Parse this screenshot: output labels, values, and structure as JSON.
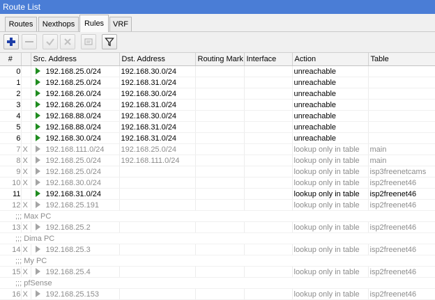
{
  "window": {
    "title": "Route List"
  },
  "tabs": [
    {
      "label": "Routes",
      "active": false
    },
    {
      "label": "Nexthops",
      "active": false
    },
    {
      "label": "Rules",
      "active": true
    },
    {
      "label": "VRF",
      "active": false
    }
  ],
  "toolbar": [
    {
      "icon": "plus-icon",
      "enabled": true
    },
    {
      "icon": "minus-icon",
      "enabled": false
    },
    {
      "icon": "check-icon",
      "enabled": false
    },
    {
      "icon": "cross-icon",
      "enabled": false
    },
    {
      "icon": "note-icon",
      "enabled": false
    },
    {
      "icon": "filter-icon",
      "enabled": true
    }
  ],
  "columns": [
    "#",
    "",
    "Src. Address",
    "Dst. Address",
    "Routing Mark",
    "Interface",
    "Action",
    "Table"
  ],
  "rows": [
    {
      "type": "rule",
      "num": "0",
      "flag": "",
      "disabled": false,
      "src": "192.168.25.0/24",
      "dst": "192.168.30.0/24",
      "mark": "",
      "iface": "",
      "action": "unreachable",
      "table": ""
    },
    {
      "type": "rule",
      "num": "1",
      "flag": "",
      "disabled": false,
      "src": "192.168.25.0/24",
      "dst": "192.168.31.0/24",
      "mark": "",
      "iface": "",
      "action": "unreachable",
      "table": ""
    },
    {
      "type": "rule",
      "num": "2",
      "flag": "",
      "disabled": false,
      "src": "192.168.26.0/24",
      "dst": "192.168.30.0/24",
      "mark": "",
      "iface": "",
      "action": "unreachable",
      "table": ""
    },
    {
      "type": "rule",
      "num": "3",
      "flag": "",
      "disabled": false,
      "src": "192.168.26.0/24",
      "dst": "192.168.31.0/24",
      "mark": "",
      "iface": "",
      "action": "unreachable",
      "table": ""
    },
    {
      "type": "rule",
      "num": "4",
      "flag": "",
      "disabled": false,
      "src": "192.168.88.0/24",
      "dst": "192.168.30.0/24",
      "mark": "",
      "iface": "",
      "action": "unreachable",
      "table": ""
    },
    {
      "type": "rule",
      "num": "5",
      "flag": "",
      "disabled": false,
      "src": "192.168.88.0/24",
      "dst": "192.168.31.0/24",
      "mark": "",
      "iface": "",
      "action": "unreachable",
      "table": ""
    },
    {
      "type": "rule",
      "num": "6",
      "flag": "",
      "disabled": false,
      "src": "192.168.30.0/24",
      "dst": "192.168.31.0/24",
      "mark": "",
      "iface": "",
      "action": "unreachable",
      "table": ""
    },
    {
      "type": "rule",
      "num": "7",
      "flag": "X",
      "disabled": true,
      "src": "192.168.111.0/24",
      "dst": "192.168.25.0/24",
      "mark": "",
      "iface": "",
      "action": "lookup only in table",
      "table": "main"
    },
    {
      "type": "rule",
      "num": "8",
      "flag": "X",
      "disabled": true,
      "src": "192.168.25.0/24",
      "dst": "192.168.111.0/24",
      "mark": "",
      "iface": "",
      "action": "lookup only in table",
      "table": "main"
    },
    {
      "type": "rule",
      "num": "9",
      "flag": "X",
      "disabled": true,
      "src": "192.168.25.0/24",
      "dst": "",
      "mark": "",
      "iface": "",
      "action": "lookup only in table",
      "table": "isp3freenetcams"
    },
    {
      "type": "rule",
      "num": "10",
      "flag": "X",
      "disabled": true,
      "src": "192.168.30.0/24",
      "dst": "",
      "mark": "",
      "iface": "",
      "action": "lookup only in table",
      "table": "isp2freenet46"
    },
    {
      "type": "rule",
      "num": "11",
      "flag": "",
      "disabled": false,
      "src": "192.168.31.0/24",
      "dst": "",
      "mark": "",
      "iface": "",
      "action": "lookup only in table",
      "table": "isp2freenet46"
    },
    {
      "type": "rule",
      "num": "12",
      "flag": "X",
      "disabled": true,
      "src": "192.168.25.191",
      "dst": "",
      "mark": "",
      "iface": "",
      "action": "lookup only in table",
      "table": "isp2freenet46"
    },
    {
      "type": "comment",
      "text": ";;; Max PC"
    },
    {
      "type": "rule",
      "num": "13",
      "flag": "X",
      "disabled": true,
      "src": "192.168.25.2",
      "dst": "",
      "mark": "",
      "iface": "",
      "action": "lookup only in table",
      "table": "isp2freenet46"
    },
    {
      "type": "comment",
      "text": ";;; Dima PC"
    },
    {
      "type": "rule",
      "num": "14",
      "flag": "X",
      "disabled": true,
      "src": "192.168.25.3",
      "dst": "",
      "mark": "",
      "iface": "",
      "action": "lookup only in table",
      "table": "isp2freenet46"
    },
    {
      "type": "comment",
      "text": ";;; My PC"
    },
    {
      "type": "rule",
      "num": "15",
      "flag": "X",
      "disabled": true,
      "src": "192.168.25.4",
      "dst": "",
      "mark": "",
      "iface": "",
      "action": "lookup only in table",
      "table": "isp2freenet46"
    },
    {
      "type": "comment",
      "text": ";;; pfSense"
    },
    {
      "type": "rule",
      "num": "16",
      "flag": "X",
      "disabled": true,
      "src": "192.168.25.153",
      "dst": "",
      "mark": "",
      "iface": "",
      "action": "lookup only in table",
      "table": "isp2freenet46"
    }
  ]
}
